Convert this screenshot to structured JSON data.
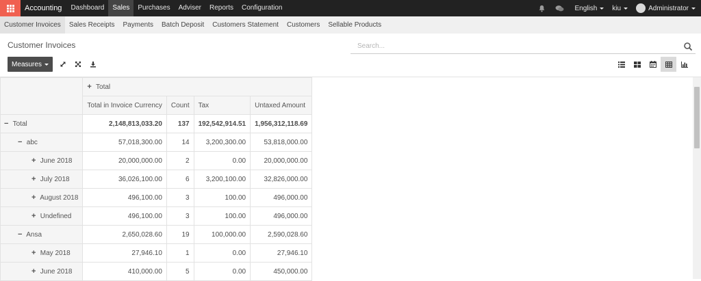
{
  "topbar": {
    "app_name": "Accounting",
    "menu": [
      "Dashboard",
      "Sales",
      "Purchases",
      "Adviser",
      "Reports",
      "Configuration"
    ],
    "active_menu": "Sales",
    "language": "English",
    "company": "kiu",
    "user": "Administrator"
  },
  "subnav": {
    "items": [
      "Customer Invoices",
      "Sales Receipts",
      "Payments",
      "Batch Deposit",
      "Customers Statement",
      "Customers",
      "Sellable Products"
    ],
    "active": "Customer Invoices"
  },
  "control_panel": {
    "title": "Customer Invoices",
    "search_placeholder": "Search...",
    "measures_label": "Measures"
  },
  "pivot": {
    "col_header_total": "Total",
    "measures": [
      "Total in Invoice Currency",
      "Count",
      "Tax",
      "Untaxed Amount"
    ],
    "rows": [
      {
        "label": "Total",
        "level": 0,
        "sign": "−",
        "bold": true,
        "values": [
          "2,148,813,033.20",
          "137",
          "192,542,914.51",
          "1,956,312,118.69"
        ]
      },
      {
        "label": "abc",
        "level": 1,
        "sign": "−",
        "bold": false,
        "values": [
          "57,018,300.00",
          "14",
          "3,200,300.00",
          "53,818,000.00"
        ]
      },
      {
        "label": "June 2018",
        "level": 2,
        "sign": "+",
        "bold": false,
        "values": [
          "20,000,000.00",
          "2",
          "0.00",
          "20,000,000.00"
        ]
      },
      {
        "label": "July 2018",
        "level": 2,
        "sign": "+",
        "bold": false,
        "values": [
          "36,026,100.00",
          "6",
          "3,200,100.00",
          "32,826,000.00"
        ]
      },
      {
        "label": "August 2018",
        "level": 2,
        "sign": "+",
        "bold": false,
        "values": [
          "496,100.00",
          "3",
          "100.00",
          "496,000.00"
        ]
      },
      {
        "label": "Undefined",
        "level": 2,
        "sign": "+",
        "bold": false,
        "values": [
          "496,100.00",
          "3",
          "100.00",
          "496,000.00"
        ]
      },
      {
        "label": "Ansa",
        "level": 1,
        "sign": "−",
        "bold": false,
        "values": [
          "2,650,028.60",
          "19",
          "100,000.00",
          "2,590,028.60"
        ]
      },
      {
        "label": "May 2018",
        "level": 2,
        "sign": "+",
        "bold": false,
        "values": [
          "27,946.10",
          "1",
          "0.00",
          "27,946.10"
        ]
      },
      {
        "label": "June 2018",
        "level": 2,
        "sign": "+",
        "bold": false,
        "values": [
          "410,000.00",
          "5",
          "0.00",
          "450,000.00"
        ]
      }
    ]
  },
  "colors": {
    "navbar_bg": "#222222",
    "apps_accent": "#f06050",
    "active_menu_bg": "#444444",
    "subnav_bg": "#f0f0f0",
    "measures_btn_bg": "#4c4c4c"
  }
}
